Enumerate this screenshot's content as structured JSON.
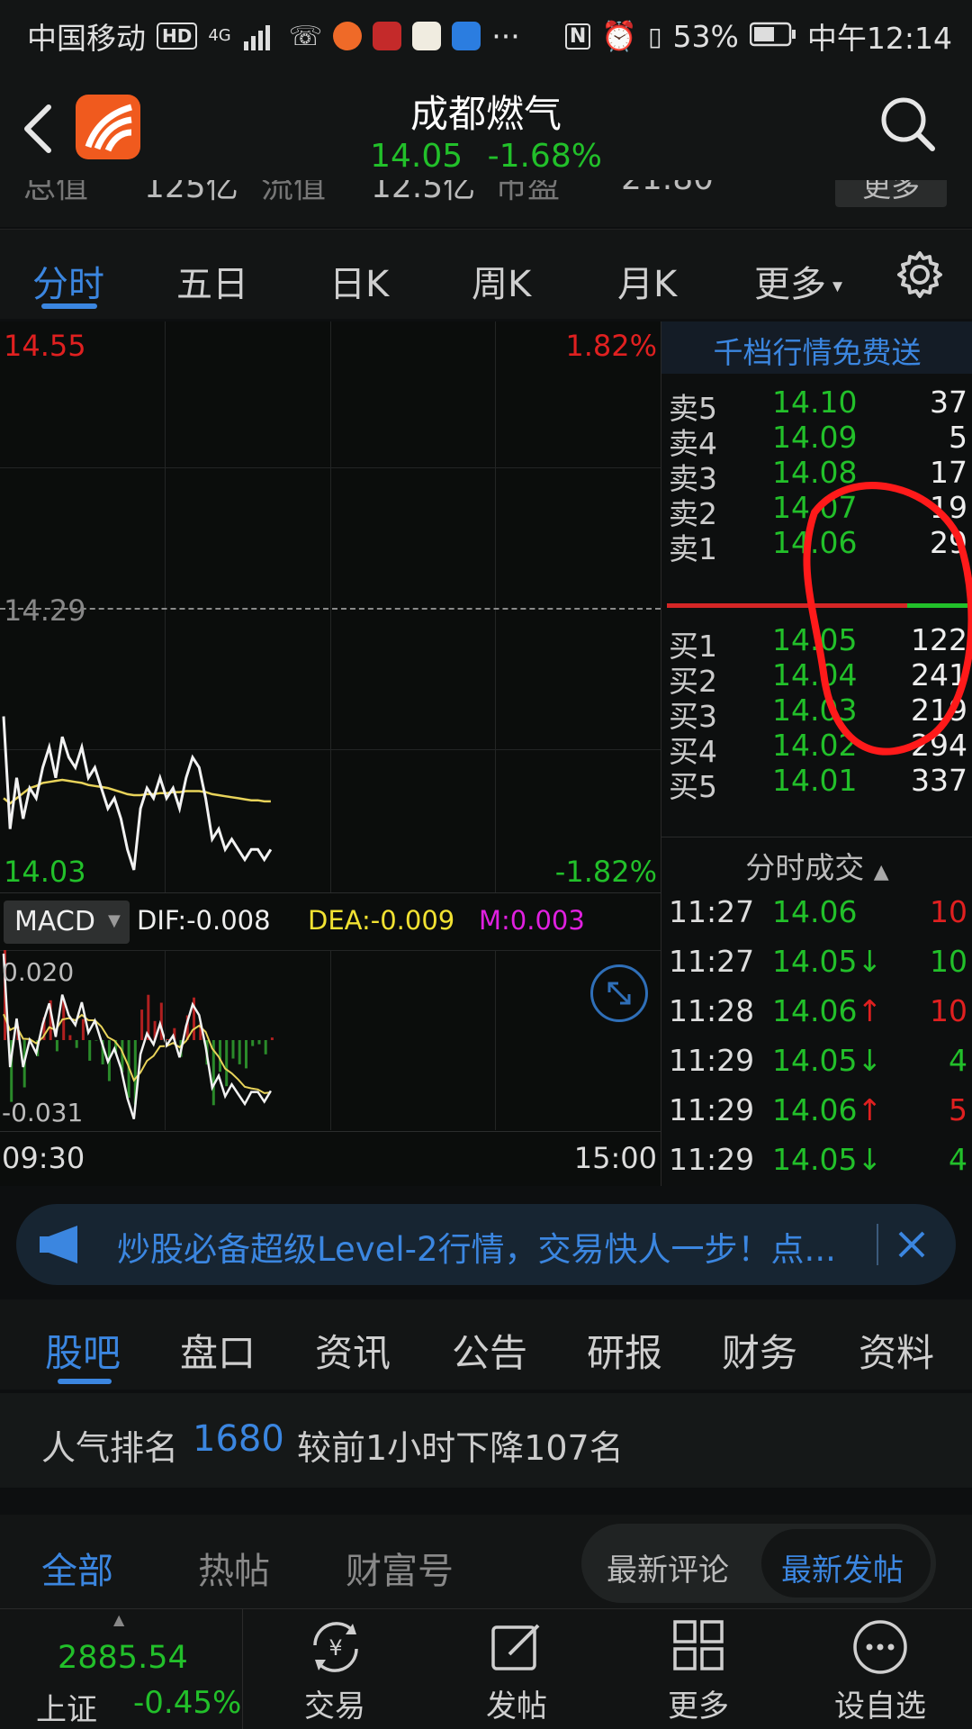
{
  "status_bar": {
    "carrier": "中国移动",
    "hd": "HD",
    "network": "4G",
    "more": "···",
    "battery": "53%",
    "time": "中午12:14"
  },
  "header": {
    "title": "成都燃气",
    "price": "14.05",
    "change": "-1.68%"
  },
  "cut_row": {
    "c1": "总值",
    "v1": "125亿",
    "c2": "流值",
    "v2": "12.5亿",
    "c3": "市盈",
    "v3": "21.80",
    "more": "更多"
  },
  "chart_tabs": [
    "分时",
    "五日",
    "日K",
    "周K",
    "月K",
    "更多"
  ],
  "chart": {
    "price_high": "14.55",
    "pct_high": "1.82%",
    "prev_close": "14.29",
    "price_low": "14.03",
    "pct_low": "-1.82%",
    "indicator": "MACD",
    "dif": "DIF:-0.008",
    "dea": "DEA:-0.009",
    "m": "M:0.003",
    "macd_high": "0.020",
    "macd_low": "-0.031",
    "time_start": "09:30",
    "time_end": "15:00"
  },
  "chart_data": {
    "type": "line",
    "ylim": [
      14.03,
      14.55
    ],
    "prev_close": 14.29,
    "series": [
      {
        "values": [
          14.18,
          14.07,
          14.12,
          14.08,
          14.11,
          14.1,
          14.13,
          14.15,
          14.12,
          14.16,
          14.14,
          14.13,
          14.15,
          14.12,
          14.13,
          14.11,
          14.09,
          14.1,
          14.08,
          14.05,
          14.03,
          14.09,
          14.11,
          14.1,
          14.12,
          14.1,
          14.11,
          14.09,
          14.12,
          14.14,
          14.13,
          14.1,
          14.06,
          14.07,
          14.05,
          14.06,
          14.05,
          14.04,
          14.05,
          14.05,
          14.04,
          14.05
        ]
      },
      {
        "values": [
          14.1,
          14.095,
          14.1,
          14.105,
          14.11,
          14.112,
          14.115,
          14.116,
          14.117,
          14.118,
          14.117,
          14.116,
          14.115,
          14.113,
          14.112,
          14.111,
          14.11,
          14.108,
          14.106,
          14.104,
          14.103,
          14.103,
          14.104,
          14.104,
          14.105,
          14.105,
          14.106,
          14.106,
          14.107,
          14.107,
          14.107,
          14.106,
          14.104,
          14.103,
          14.102,
          14.101,
          14.1,
          14.099,
          14.098,
          14.098,
          14.097,
          14.097
        ]
      }
    ]
  },
  "order_book": {
    "promo": "千档行情免费送",
    "sells": [
      {
        "label": "卖5",
        "price": "14.10",
        "vol": "37"
      },
      {
        "label": "卖4",
        "price": "14.09",
        "vol": "5"
      },
      {
        "label": "卖3",
        "price": "14.08",
        "vol": "17"
      },
      {
        "label": "卖2",
        "price": "14.07",
        "vol": "19"
      },
      {
        "label": "卖1",
        "price": "14.06",
        "vol": "29"
      }
    ],
    "buys": [
      {
        "label": "买1",
        "price": "14.05",
        "vol": "122"
      },
      {
        "label": "买2",
        "price": "14.04",
        "vol": "241"
      },
      {
        "label": "买3",
        "price": "14.03",
        "vol": "219"
      },
      {
        "label": "买4",
        "price": "14.02",
        "vol": "294"
      },
      {
        "label": "买5",
        "price": "14.01",
        "vol": "337"
      }
    ],
    "trades_title": "分时成交",
    "trades": [
      {
        "time": "11:27",
        "price": "14.06",
        "arrow": "",
        "vol": "10"
      },
      {
        "time": "11:27",
        "price": "14.05↓",
        "arrow": "down",
        "vol": "10"
      },
      {
        "time": "11:28",
        "price": "14.06↑",
        "arrow": "up",
        "vol": "10"
      },
      {
        "time": "11:29",
        "price": "14.05↓",
        "arrow": "down",
        "vol": "4"
      },
      {
        "time": "11:29",
        "price": "14.06↑",
        "arrow": "up",
        "vol": "5"
      },
      {
        "time": "11:29",
        "price": "14.05↓",
        "arrow": "down",
        "vol": "4"
      }
    ]
  },
  "banner": {
    "text": "炒股必备超级Level-2行情，交易快人一步！点..."
  },
  "info_tabs": [
    "股吧",
    "盘口",
    "资讯",
    "公告",
    "研报",
    "财务",
    "资料"
  ],
  "rank": {
    "prefix": "人气排名",
    "number": "1680",
    "suffix": "较前1小时下降107名"
  },
  "feed_tabs": {
    "tabs": [
      "全部",
      "热帖",
      "财富号"
    ],
    "sort_latest_comment": "最新评论",
    "sort_latest_post": "最新发帖"
  },
  "bottom_nav": {
    "index_value": "2885.54",
    "index_name": "上证",
    "index_change": "-0.45%",
    "trade": "交易",
    "post": "发帖",
    "more": "更多",
    "add_watch": "设自选"
  },
  "colors": {
    "up": "#e02020",
    "down": "#22c02a",
    "accent": "#3b86e0",
    "price_line": "#f2f2f2",
    "avg_line": "#e8d35a",
    "annotation": "#ff1a1a"
  }
}
